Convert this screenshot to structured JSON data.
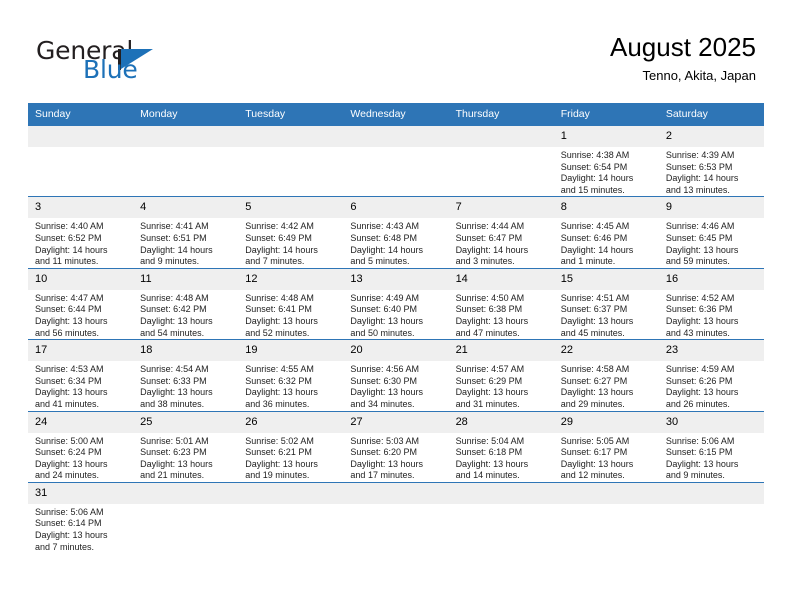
{
  "brand": {
    "name_top": "General",
    "name_bottom": "Blue",
    "triangle_icon": "triangle-icon",
    "accent_color": "#1d71b8",
    "text_color": "#231f20"
  },
  "header": {
    "title": "August 2025",
    "subtitle": "Tenno, Akita, Japan"
  },
  "calendar": {
    "header_color": "#2e75b6",
    "daynum_bg": "#efefef",
    "weekday_headers": [
      "Sunday",
      "Monday",
      "Tuesday",
      "Wednesday",
      "Thursday",
      "Friday",
      "Saturday"
    ],
    "weeks": [
      [
        {
          "day": "",
          "info": ""
        },
        {
          "day": "",
          "info": ""
        },
        {
          "day": "",
          "info": ""
        },
        {
          "day": "",
          "info": ""
        },
        {
          "day": "",
          "info": ""
        },
        {
          "day": "1",
          "info": "Sunrise: 4:38 AM\nSunset: 6:54 PM\nDaylight: 14 hours\nand 15 minutes."
        },
        {
          "day": "2",
          "info": "Sunrise: 4:39 AM\nSunset: 6:53 PM\nDaylight: 14 hours\nand 13 minutes."
        }
      ],
      [
        {
          "day": "3",
          "info": "Sunrise: 4:40 AM\nSunset: 6:52 PM\nDaylight: 14 hours\nand 11 minutes."
        },
        {
          "day": "4",
          "info": "Sunrise: 4:41 AM\nSunset: 6:51 PM\nDaylight: 14 hours\nand 9 minutes."
        },
        {
          "day": "5",
          "info": "Sunrise: 4:42 AM\nSunset: 6:49 PM\nDaylight: 14 hours\nand 7 minutes."
        },
        {
          "day": "6",
          "info": "Sunrise: 4:43 AM\nSunset: 6:48 PM\nDaylight: 14 hours\nand 5 minutes."
        },
        {
          "day": "7",
          "info": "Sunrise: 4:44 AM\nSunset: 6:47 PM\nDaylight: 14 hours\nand 3 minutes."
        },
        {
          "day": "8",
          "info": "Sunrise: 4:45 AM\nSunset: 6:46 PM\nDaylight: 14 hours\nand 1 minute."
        },
        {
          "day": "9",
          "info": "Sunrise: 4:46 AM\nSunset: 6:45 PM\nDaylight: 13 hours\nand 59 minutes."
        }
      ],
      [
        {
          "day": "10",
          "info": "Sunrise: 4:47 AM\nSunset: 6:44 PM\nDaylight: 13 hours\nand 56 minutes."
        },
        {
          "day": "11",
          "info": "Sunrise: 4:48 AM\nSunset: 6:42 PM\nDaylight: 13 hours\nand 54 minutes."
        },
        {
          "day": "12",
          "info": "Sunrise: 4:48 AM\nSunset: 6:41 PM\nDaylight: 13 hours\nand 52 minutes."
        },
        {
          "day": "13",
          "info": "Sunrise: 4:49 AM\nSunset: 6:40 PM\nDaylight: 13 hours\nand 50 minutes."
        },
        {
          "day": "14",
          "info": "Sunrise: 4:50 AM\nSunset: 6:38 PM\nDaylight: 13 hours\nand 47 minutes."
        },
        {
          "day": "15",
          "info": "Sunrise: 4:51 AM\nSunset: 6:37 PM\nDaylight: 13 hours\nand 45 minutes."
        },
        {
          "day": "16",
          "info": "Sunrise: 4:52 AM\nSunset: 6:36 PM\nDaylight: 13 hours\nand 43 minutes."
        }
      ],
      [
        {
          "day": "17",
          "info": "Sunrise: 4:53 AM\nSunset: 6:34 PM\nDaylight: 13 hours\nand 41 minutes."
        },
        {
          "day": "18",
          "info": "Sunrise: 4:54 AM\nSunset: 6:33 PM\nDaylight: 13 hours\nand 38 minutes."
        },
        {
          "day": "19",
          "info": "Sunrise: 4:55 AM\nSunset: 6:32 PM\nDaylight: 13 hours\nand 36 minutes."
        },
        {
          "day": "20",
          "info": "Sunrise: 4:56 AM\nSunset: 6:30 PM\nDaylight: 13 hours\nand 34 minutes."
        },
        {
          "day": "21",
          "info": "Sunrise: 4:57 AM\nSunset: 6:29 PM\nDaylight: 13 hours\nand 31 minutes."
        },
        {
          "day": "22",
          "info": "Sunrise: 4:58 AM\nSunset: 6:27 PM\nDaylight: 13 hours\nand 29 minutes."
        },
        {
          "day": "23",
          "info": "Sunrise: 4:59 AM\nSunset: 6:26 PM\nDaylight: 13 hours\nand 26 minutes."
        }
      ],
      [
        {
          "day": "24",
          "info": "Sunrise: 5:00 AM\nSunset: 6:24 PM\nDaylight: 13 hours\nand 24 minutes."
        },
        {
          "day": "25",
          "info": "Sunrise: 5:01 AM\nSunset: 6:23 PM\nDaylight: 13 hours\nand 21 minutes."
        },
        {
          "day": "26",
          "info": "Sunrise: 5:02 AM\nSunset: 6:21 PM\nDaylight: 13 hours\nand 19 minutes."
        },
        {
          "day": "27",
          "info": "Sunrise: 5:03 AM\nSunset: 6:20 PM\nDaylight: 13 hours\nand 17 minutes."
        },
        {
          "day": "28",
          "info": "Sunrise: 5:04 AM\nSunset: 6:18 PM\nDaylight: 13 hours\nand 14 minutes."
        },
        {
          "day": "29",
          "info": "Sunrise: 5:05 AM\nSunset: 6:17 PM\nDaylight: 13 hours\nand 12 minutes."
        },
        {
          "day": "30",
          "info": "Sunrise: 5:06 AM\nSunset: 6:15 PM\nDaylight: 13 hours\nand 9 minutes."
        }
      ],
      [
        {
          "day": "31",
          "info": "Sunrise: 5:06 AM\nSunset: 6:14 PM\nDaylight: 13 hours\nand 7 minutes."
        },
        {
          "day": "",
          "info": ""
        },
        {
          "day": "",
          "info": ""
        },
        {
          "day": "",
          "info": ""
        },
        {
          "day": "",
          "info": ""
        },
        {
          "day": "",
          "info": ""
        },
        {
          "day": "",
          "info": ""
        }
      ]
    ]
  }
}
